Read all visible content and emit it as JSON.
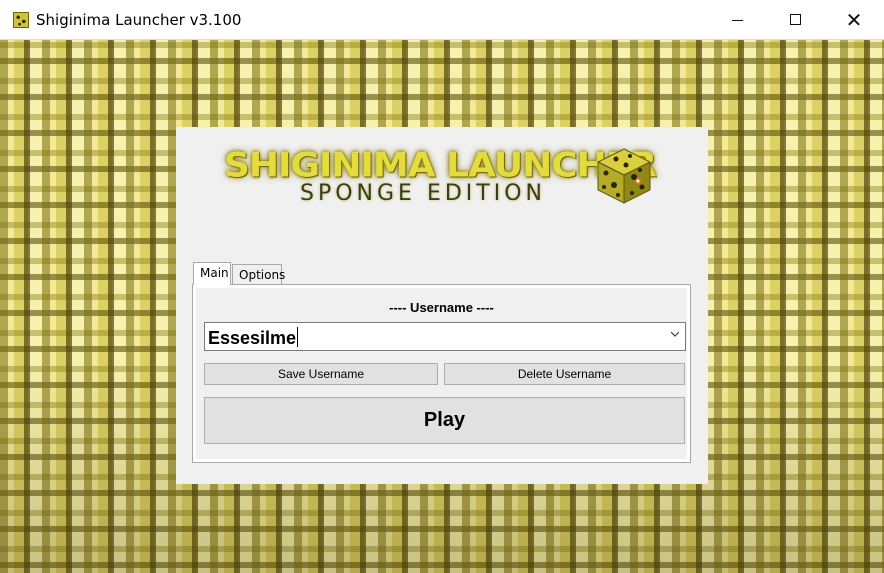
{
  "window": {
    "title": "Shiginima Launcher v3.100",
    "icon": "sponge-block-icon",
    "controls": [
      "minimize",
      "maximize",
      "close"
    ]
  },
  "logo": {
    "title": "SHIGINIMA LAUNCHER",
    "subtitle": "SPONGE EDITION"
  },
  "tabs": [
    {
      "label": "Main",
      "selected": true
    },
    {
      "label": "Options",
      "selected": false
    }
  ],
  "main": {
    "section_label": "---- Username ----",
    "username_value": "Essesilme",
    "save_label": "Save Username",
    "delete_label": "Delete Username",
    "play_label": "Play"
  },
  "colors": {
    "panel_bg": "#f0f0f0",
    "sponge_yellow": "#e4db3c",
    "button_bg": "#e1e1e1"
  }
}
